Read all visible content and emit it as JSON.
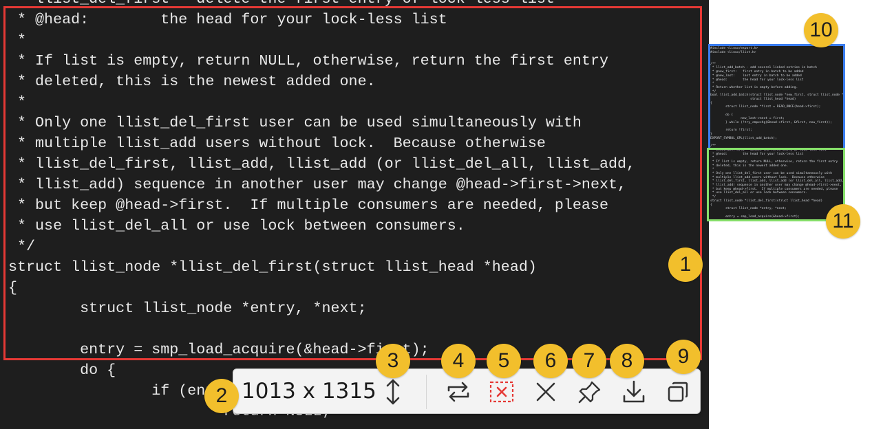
{
  "code_lines": [
    " * llist_del_first - delete the first entry of lock-less list",
    " * @head:        the head for your lock-less list",
    " *",
    " * If list is empty, return NULL, otherwise, return the first entry",
    " * deleted, this is the newest added one.",
    " *",
    " * Only one llist_del_first user can be used simultaneously with",
    " * multiple llist_add users without lock.  Because otherwise",
    " * llist_del_first, llist_add, llist_add (or llist_del_all, llist_add,",
    " * llist_add) sequence in another user may change @head->first->next,",
    " * but keep @head->first.  If multiple consumers are needed, please",
    " * use llist_del_all or use lock between consumers.",
    " */",
    "struct llist_node *llist_del_first(struct llist_head *head)",
    "{",
    "        struct llist_node *entry, *next;",
    "",
    "        entry = smp_load_acquire(&head->first);",
    "        do {",
    "                if (entry == NULL)",
    "                        return NULL;"
  ],
  "minimap_lines": [
    "#include <linux/export.h>",
    "#include <linux/llist.h>",
    "",
    "",
    "/**",
    " * llist_add_batch - add several linked entries in batch",
    " * @new_first:   first entry in batch to be added",
    " * @new_last:    last entry in batch to be added",
    " * @head:        the head for your lock-less list",
    " *",
    " * Return whether list is empty before adding.",
    " */",
    "bool llist_add_batch(struct llist_node *new_first, struct llist_node *new_last,",
    "                     struct llist_head *head)",
    "{",
    "        struct llist_node *first = READ_ONCE(head->first);",
    "",
    "        do {",
    "                new_last->next = first;",
    "        } while (!try_cmpxchg(&head->first, &first, new_first));",
    "",
    "        return !first;",
    "}",
    "EXPORT_SYMBOL_GPL(llist_add_batch);",
    "",
    "/**",
    " * llist_del_first - delete the first entry of lock-less list",
    " * @head:        the head for your lock-less list",
    " *",
    " * If list is empty, return NULL, otherwise, return the first entry",
    " * deleted, this is the newest added one.",
    " *",
    " * Only one llist_del_first user can be used simultaneously with",
    " * multiple llist_add users without lock.  Because otherwise",
    " * llist_del_first, llist_add, llist_add (or llist_del_all, llist_add,",
    " * llist_add) sequence in another user may change @head->first->next,",
    " * but keep @head->first.  If multiple consumers are needed, please",
    " * use llist_del_all or use lock between consumers.",
    " */",
    "struct llist_node *llist_del_first(struct llist_head *head)",
    "{",
    "        struct llist_node *entry, *next;",
    "",
    "        entry = smp_load_acquire(&head->first);"
  ],
  "toolbar": {
    "size_readout": "1013 x 1315",
    "buttons": [
      {
        "name": "resize-vertical-button",
        "icon": "vertical-arrows-icon"
      },
      {
        "name": "repeat-button",
        "icon": "repeat-icon"
      },
      {
        "name": "cancel-selection-button",
        "icon": "cancel-selection-icon"
      },
      {
        "name": "close-button",
        "icon": "close-icon"
      },
      {
        "name": "pin-button",
        "icon": "pin-icon"
      },
      {
        "name": "save-button",
        "icon": "download-icon"
      },
      {
        "name": "copy-button",
        "icon": "copy-icon"
      }
    ]
  },
  "badges": {
    "b1": "1",
    "b2": "2",
    "b3": "3",
    "b4": "4",
    "b5": "5",
    "b6": "6",
    "b7": "7",
    "b8": "8",
    "b9": "9",
    "b10": "10",
    "b11": "11"
  },
  "colors": {
    "code_background": "#1e1e1e",
    "code_text": "#e8e8e8",
    "capture_border": "#e53935",
    "minimap_blue_border": "#3a7df0",
    "minimap_green_border": "#86e06a",
    "badge_fill": "#f2bf2c",
    "toolbar_background": "#f3f3f3",
    "cancel_icon": "#e53935"
  }
}
